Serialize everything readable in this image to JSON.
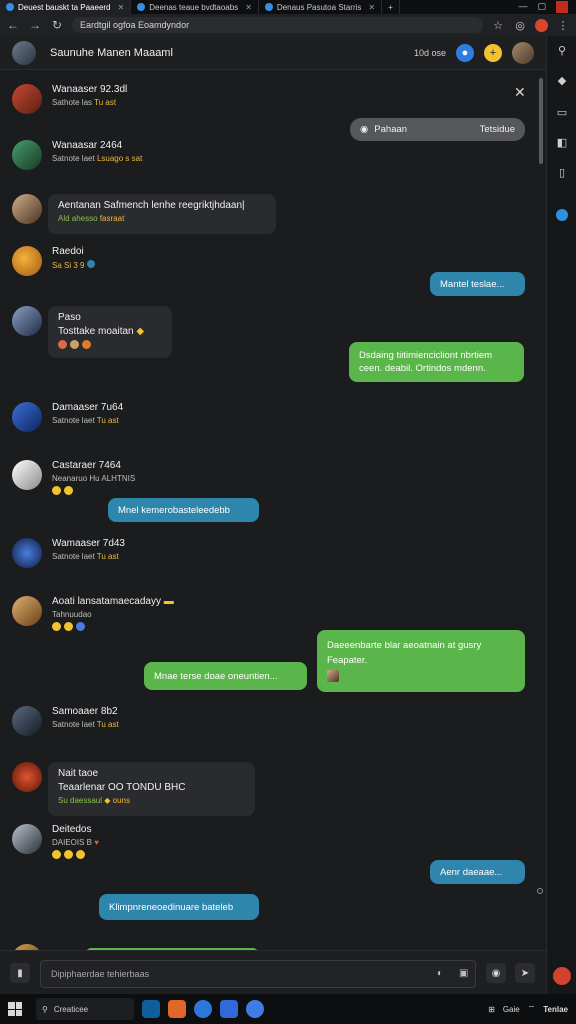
{
  "browser": {
    "tabs": [
      {
        "label": "Deuest bauskt ta Paaeerd"
      },
      {
        "label": "Deenas teaue bvdtaoabs"
      },
      {
        "label": "Denaus Pasutoa Starris"
      }
    ],
    "url": "Eardtgil ogfoa Eoamdyndor"
  },
  "chat_header": {
    "title": "Saunuhe Manen Maaaml",
    "meta": "10d ose"
  },
  "messages": [
    {
      "name": "Wanaaser 92.3dl",
      "sub": "Sathote las",
      "sub_hl": "Tu ast"
    },
    {
      "name": "Wanaasar 2464",
      "sub": "Satnote laet",
      "sub_hl": "Lsuago s sat"
    },
    {
      "name": "Aentanan Safmench lenhe reegriktjhdaan|",
      "sub": "Ald ahesso",
      "sub_hl": "fasraat"
    },
    {
      "name": "Raedoi",
      "sub": "",
      "sub_hl": "Sa Si 3 9"
    },
    {
      "name": "Paso",
      "text": "Tosttake moaitan"
    },
    {
      "name": "Damaaser 7u64",
      "sub": "Satnote laet",
      "sub_hl": "Tu ast"
    },
    {
      "name": "Castaraer 7464",
      "sub": "Neanaruo Hu ALHTNIS",
      "sub_hl": ""
    },
    {
      "name": "Wamaaser 7d43",
      "sub": "Satnote laet",
      "sub_hl": "Tu ast"
    },
    {
      "name": "Aoati lansatamaecadayy",
      "sub": "Tahnuudao",
      "sub_hl": ""
    },
    {
      "name": "Samoaaer 8b2",
      "sub": "Satnote laet",
      "sub_hl": "Tu ast"
    },
    {
      "name": "Nait taoe",
      "text": "Teaarlenar OO TONDU BHC",
      "sub": "Su daessaul",
      "sub_hl": "ouns"
    },
    {
      "name": "Deitedos",
      "sub": "DAIEOIS B",
      "sub_hl": ""
    }
  ],
  "bubbles": {
    "grey_pill": "Pahaan",
    "grey_pill_right": "Tetsidue",
    "blue1": "Mantel teslae...",
    "green1_line1": "Dsdaing tiitimiencicliont nbrtiem",
    "green1_line2": "ceen. deabil. Ortindos mdenn.",
    "blue2": "Mnel kemerobasteleedebb",
    "green2_line1": "Daeeenbarte blar aeoatnain at gusry",
    "green2_line2": "Feapater.",
    "green3": "Mnae terse doae oneuntien...",
    "blue3": "Aenr daeaae...",
    "blue4": "Klimpnreneoedinuare bateleb"
  },
  "composer": {
    "placeholder": "Dipiphaerdae tehierbaas"
  },
  "taskbar": {
    "search": "Creaticee",
    "tray_text": "Gaie",
    "tray_label": "Tenlae"
  },
  "colors": {
    "background": "#1b1c1e",
    "bubble_blue": "#2f86ad",
    "bubble_green": "#5ab54a",
    "bubble_grey": "#55575b"
  }
}
